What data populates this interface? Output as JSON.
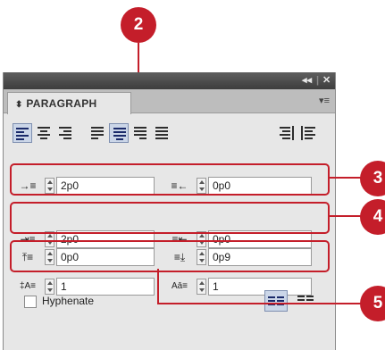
{
  "panel": {
    "title": "PARAGRAPH",
    "collapse_icon": "double-chevron-left-icon",
    "collapse_glyph": "◂◂",
    "close_icon": "close-icon",
    "close_glyph": "✕",
    "tab_toggle_glyph": "⬍",
    "menu_glyph": "▾≡"
  },
  "alignment_buttons": [
    {
      "name": "align-left",
      "selected": true
    },
    {
      "name": "align-center",
      "selected": false
    },
    {
      "name": "align-right",
      "selected": false
    },
    {
      "name": "justify-left",
      "selected": false
    },
    {
      "name": "justify-center",
      "selected": true
    },
    {
      "name": "justify-right",
      "selected": false
    },
    {
      "name": "justify-all",
      "selected": false
    },
    {
      "name": "align-towards-spine",
      "selected": false
    },
    {
      "name": "align-away-from-spine",
      "selected": false
    }
  ],
  "fields": {
    "left_indent": "2p0",
    "right_indent": "0p0",
    "first_line_indent": "2p0",
    "last_line_right_indent": "0p0",
    "space_before": "0p0",
    "space_after": "0p9",
    "drop_cap_lines": "1",
    "drop_cap_chars": "1"
  },
  "field_icons": {
    "left_indent": "→≡",
    "right_indent": "≡←",
    "first_line_indent": "⇥≡",
    "last_line_right_indent": "≡⇤",
    "space_before": "⤒≡",
    "space_after": "≡⤓",
    "drop_cap_lines": "‡A≡",
    "drop_cap_chars": "Aā≡"
  },
  "hyphenate": {
    "label": "Hyphenate",
    "checked": false
  },
  "callouts": [
    "2",
    "3",
    "4",
    "5"
  ],
  "colors": {
    "callout": "#c41e2a",
    "panel_bg": "#e7e7e7",
    "selected_bg": "#cbd6e8"
  }
}
